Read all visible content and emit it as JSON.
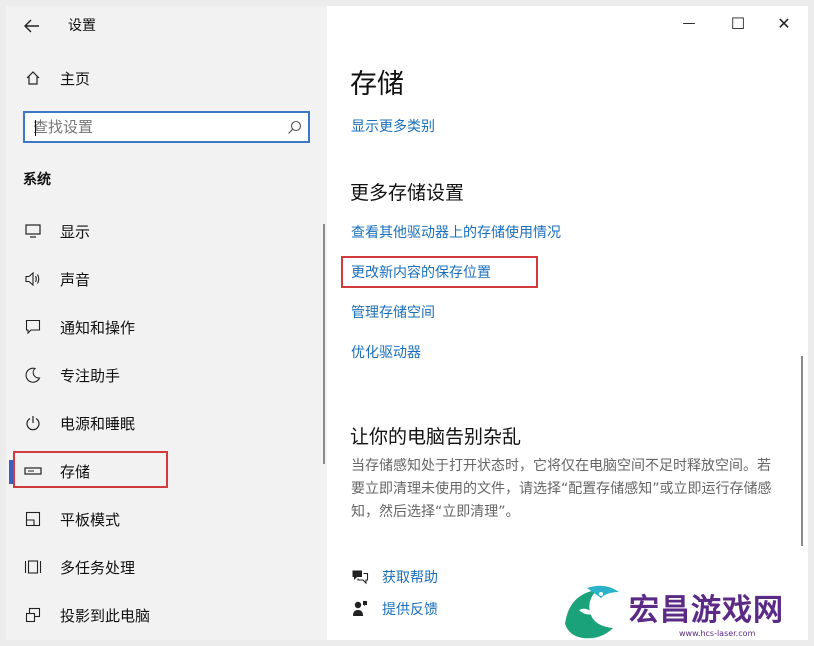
{
  "window": {
    "title": "设置",
    "minimize_glyph": "—",
    "maximize_glyph": "☐",
    "close_glyph": "✕"
  },
  "sidebar": {
    "home_label": "主页",
    "search_placeholder": "查找设置",
    "section_label": "系统",
    "items": [
      {
        "label": "显示",
        "icon": "monitor-icon"
      },
      {
        "label": "声音",
        "icon": "speaker-icon"
      },
      {
        "label": "通知和操作",
        "icon": "notification-icon"
      },
      {
        "label": "专注助手",
        "icon": "moon-icon"
      },
      {
        "label": "电源和睡眠",
        "icon": "power-icon"
      },
      {
        "label": "存储",
        "icon": "storage-icon",
        "selected": true
      },
      {
        "label": "平板模式",
        "icon": "tablet-icon"
      },
      {
        "label": "多任务处理",
        "icon": "multitask-icon"
      },
      {
        "label": "投影到此电脑",
        "icon": "project-icon"
      }
    ]
  },
  "main": {
    "title": "存储",
    "show_more_link": "显示更多类别",
    "more_settings_heading": "更多存储设置",
    "links": [
      "查看其他驱动器上的存储使用情况",
      "更改新内容的保存位置",
      "管理存储空间",
      "优化驱动器"
    ],
    "clutter_heading": "让你的电脑告别杂乱",
    "clutter_desc": "当存储感知处于打开状态时，它将仅在电脑空间不足时释放空间。若要立即清理未使用的文件，请选择“配置存储感知”或立即运行存储感知，然后选择“立即清理”。",
    "help_label": "获取帮助",
    "feedback_label": "提供反馈"
  },
  "watermark": {
    "text": "宏昌游戏网",
    "url": "www.hcs-laser.com"
  },
  "colors": {
    "accent": "#1a6fbd",
    "highlight": "#d23b3b",
    "sidebar_bg": "#f2f2f2",
    "watermark": "#5b2a86"
  }
}
